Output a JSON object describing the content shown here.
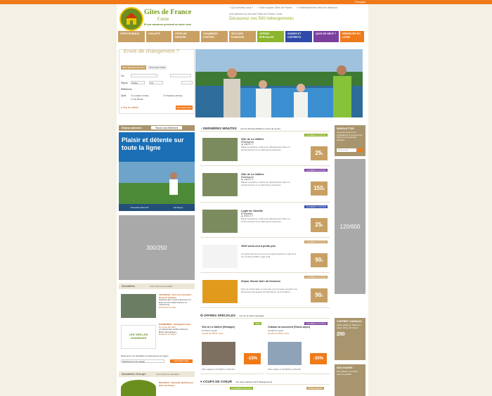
{
  "header": {
    "lang": "Français",
    "brand_line1": "Gîtes de France",
    "brand_line2": "Corse",
    "slogan": "Et vos vacances prennent un autre sens",
    "top_links": [
      "» Qui sommes-nous ?",
      "» Votre espace Gîtes de France",
      "» 5 établissements dans les alentours"
    ],
    "tagline_small": "Une adresse au nom des Gîtes de France Corse",
    "tagline_big": "Découvrez nos 500 hébergements"
  },
  "nav": [
    {
      "label": "GÎTES RURAUX",
      "color": "#c8a064"
    },
    {
      "label": "CHALETS",
      "color": "#c8a064"
    },
    {
      "label": "GÎTES DE GROUPE",
      "color": "#c8a064"
    },
    {
      "label": "CHAMBRES D'HÔTES",
      "color": "#c8a064"
    },
    {
      "label": "SÉJOURS PASSIONS",
      "color": "#c8a064"
    },
    {
      "label": "OFFRES SPÉCIALES",
      "color": "#8bb52a"
    },
    {
      "label": "GUIDES ET COFFRETS",
      "color": "#2f4aa8"
    },
    {
      "label": "QUOI DE NEUF ?",
      "color": "#7b3f9e"
    },
    {
      "label": "RÉSERVER EN LIGNE",
      "color": "#f07a1a"
    }
  ],
  "search": {
    "title": "Envie de changement ?",
    "tab1": "RECHERCHE DE GÎTE",
    "tab2": "GÎTE PAR CODE",
    "field_where": "Où",
    "field_dates": "Séjour",
    "date_from": "Début",
    "date_to": "Fin",
    "field_ref": "Référence",
    "field_type": "Quoi",
    "opt1": "Location & Gîtes",
    "opt2": "Chambres d'hôtes",
    "opt3": "City Break",
    "more": "Plus de critères",
    "submit": "RECHERCHER"
  },
  "left": {
    "selection_label": "Séjour passion",
    "selection_select": "Tous vos thèmes",
    "ad_title": "Plaisir et détente sur toute la ligne",
    "ad_footer": [
      "Nouvelles idées Wi...",
      "Montagne"
    ],
    "ad_300": "300/250",
    "news_title": "Actualités",
    "news_link": "Voir toutes les actualités",
    "news1_title": "VACANCES - Eure et Loire Entre Dreux et Chartres",
    "news1_text": "Superbe gîte 4 épis à découvrir en Eure et Loire idéal tourisme et motorhome",
    "news1_link": "Découvrez ce gîte",
    "news2_title": "EVENEMENT - Bretagne/Cordes",
    "news2_date": "Du 24 au 20 mars",
    "news2_text": "Le festival des vieilles charrues Bruce Springsteen...",
    "news2_link": "Réserver un séjour",
    "news2_logo": "LES VIEILLES CHARRUES",
    "subscribe_text": "Découvrez nos actualités et événements en région",
    "subscribe_select": "Sélectionnez une région",
    "subscribe_btn": "RECHERCHER",
    "groups_title": "Actualités Groupe",
    "groups_link": "Voir toutes les actualités",
    "groups_text": "NOUVEAU - Nouvelle identité pour Gîtes de France"
  },
  "last_minute": {
    "title": "DERNIÈRES MINUTES",
    "sub": "voir les 40 disponibilités à moins de 3 jours",
    "items": [
      {
        "title": "Gîte de La Vallière",
        "sub": "(Bretagne)",
        "desc": "Maison paysanne, propice au dépaysement dans un environnement et un patrimoine préservés...",
        "price": "25",
        "badge": "CHAMBRES D'HÔTES",
        "badge_color": "#8bb52a",
        "specs": "2  82 m²"
      },
      {
        "title": "Gîte de La Vallière",
        "sub": "(Bretagne)",
        "desc": "Maison paysanne, propice au dépaysement dans un environnement et un patrimoine préservés...",
        "price": "150",
        "badge": "CHAMBRES D'HÔTES",
        "badge_color": "#7b3f9e",
        "specs": "2  82 m²"
      },
      {
        "title": "Logis de l'Abeille",
        "sub": "(Picardie)",
        "desc": "Maison paysanne, propice au dépaysement dans un environnement et un patrimoine préservés...",
        "price": "25",
        "badge": "CHAMBRES D'HÔTES",
        "badge_color": "#2f4aa8",
        "specs": "2  82 m²"
      },
      {
        "title": "2000 week-end à petits prix",
        "sub": "",
        "desc": "Un grand tout d'un an pour tout partout partout 2 nuits du 2 au 4 octobre 2009 en gîte rural",
        "price": "90",
        "badge": "CHAMBRES D'HÔTES",
        "badge_color": "#c8a064",
        "specs": ""
      },
      {
        "title": "Séjour Savoir faire du limousin",
        "sub": "",
        "desc": "Terre de savoir faire, le Limousin vous propose de partir à la découverte des gestes de l'apiculture, de la broderie...",
        "price": "90",
        "badge": "CHAMBRES D'HÔTES",
        "badge_color": "#c8a064",
        "specs": ""
      }
    ]
  },
  "special": {
    "title": "OFFRES SPÉCIALES",
    "sub": "voir les 10 offres spéciales",
    "offers": [
      {
        "name": "Gîte de La Vallière (Bretagne)",
        "detail": "6 nuits et 7 jours",
        "price_text": "à partir de 250 € / pers.",
        "pct": "-15%",
        "valid": "Offre valable du 01/08/09 au 25/11/09",
        "badge": "NEW"
      },
      {
        "name": "Chateau du bournieret (Rhône-Alpes)",
        "detail": "6 nuits et 7 jours",
        "price_text": "à partir de 150 € / pers.",
        "pct": "-30%",
        "valid": "Offre valable du 01/08/09 au 25/11/09",
        "badge": "CHAMBRES D'HÔTES"
      }
    ]
  },
  "coups": {
    "title": "COUPS DE COEUR",
    "sub": "voir notre sélection de 8 hébergements",
    "badge1": "CHAMBRES D'HÔTES",
    "badge2": "APPARTEMENT"
  },
  "right": {
    "newsletter_title": "NEWSLETTER",
    "newsletter_text": "Inscrivez-vous à nos publications et recevez des offres et nos grandes favorites",
    "newsletter_placeholder": "Votre email",
    "ad_120": "120/600",
    "gift_title": "COFFRET CADEAUX",
    "gift_text": "Faites plaisir en offrant un séjour Gîtes de France",
    "gift_price": "250",
    "guides_title": "NOS GUIDES",
    "guides_text": "Sur tablette et en ligne : tous nos guides"
  }
}
